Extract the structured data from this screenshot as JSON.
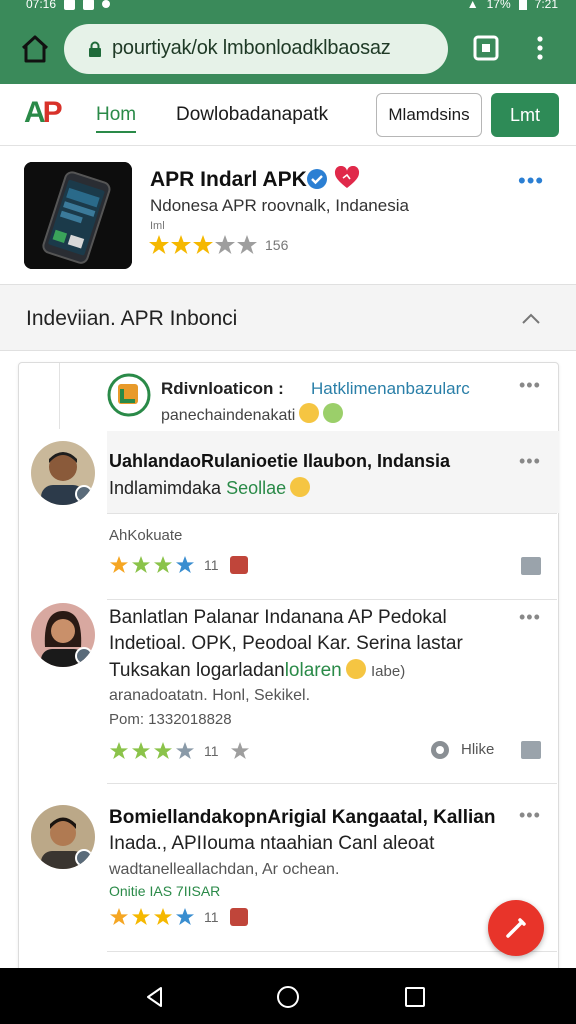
{
  "status": {
    "left_text": "07:16",
    "right_text": "17%",
    "time": "7:21"
  },
  "browser": {
    "url": "pourtiyak/ok lmbonloadklbaosaz"
  },
  "site_header": {
    "logo": "AP",
    "nav_home": "Hom",
    "nav_download": "Dowlobadanapatk",
    "btn_outline": "Mlamdsins",
    "btn_green": "Lmt"
  },
  "app": {
    "title": "APR Indarl APK",
    "subtitle": "Ndonesa APR roovnalk, Indanesia",
    "tiny": "Iml",
    "rating_count": "156",
    "rating_stars": 3,
    "more": "•••"
  },
  "section": {
    "title": "Indeviian. APR Inbonci"
  },
  "panel_top": {
    "title": "Rdivnloaticon :",
    "link": "Hatklimenanbazularc",
    "subtitle": "panechaindenakati",
    "more": "•••"
  },
  "comments": [
    {
      "name": "UahlandaoRulanioetie Ilaubon, Indansia",
      "line2": "Indlamimdaka",
      "line2_green": "Seollae",
      "meta": "AhKokuate",
      "stars": 4,
      "count": "11",
      "more": "•••"
    },
    {
      "name": "Banlatlan Palanar Indanana AP Pedokal",
      "line2": "Indetioal. OPK, Peodoal Kar. Serina lastar",
      "line3": "Tuksakan logarladan",
      "line3_green": "lolaren",
      "line3_tail": "Iabe)",
      "line4": "aranadoatatn. Honl, Sekikel.",
      "date": "Pom: 1332018828",
      "stars": 4,
      "count": "11",
      "like": "Hlike",
      "more": "•••"
    },
    {
      "name": "BomiellandakopnArigial Kangaatal, Kallian",
      "line2": "Inada., APIIouma ntaahian Canl aleoat",
      "line3": "wadtanelleallachdan, Ar ochean.",
      "line4_green": "Onitie IAS 7IISAR",
      "stars": 4,
      "count": "11",
      "more": "•••"
    }
  ],
  "colors": {
    "toolbar": "#3a8a5a",
    "accent_green": "#2e8b57",
    "fab_red": "#e8342a",
    "link_blue": "#2b7fd3"
  }
}
